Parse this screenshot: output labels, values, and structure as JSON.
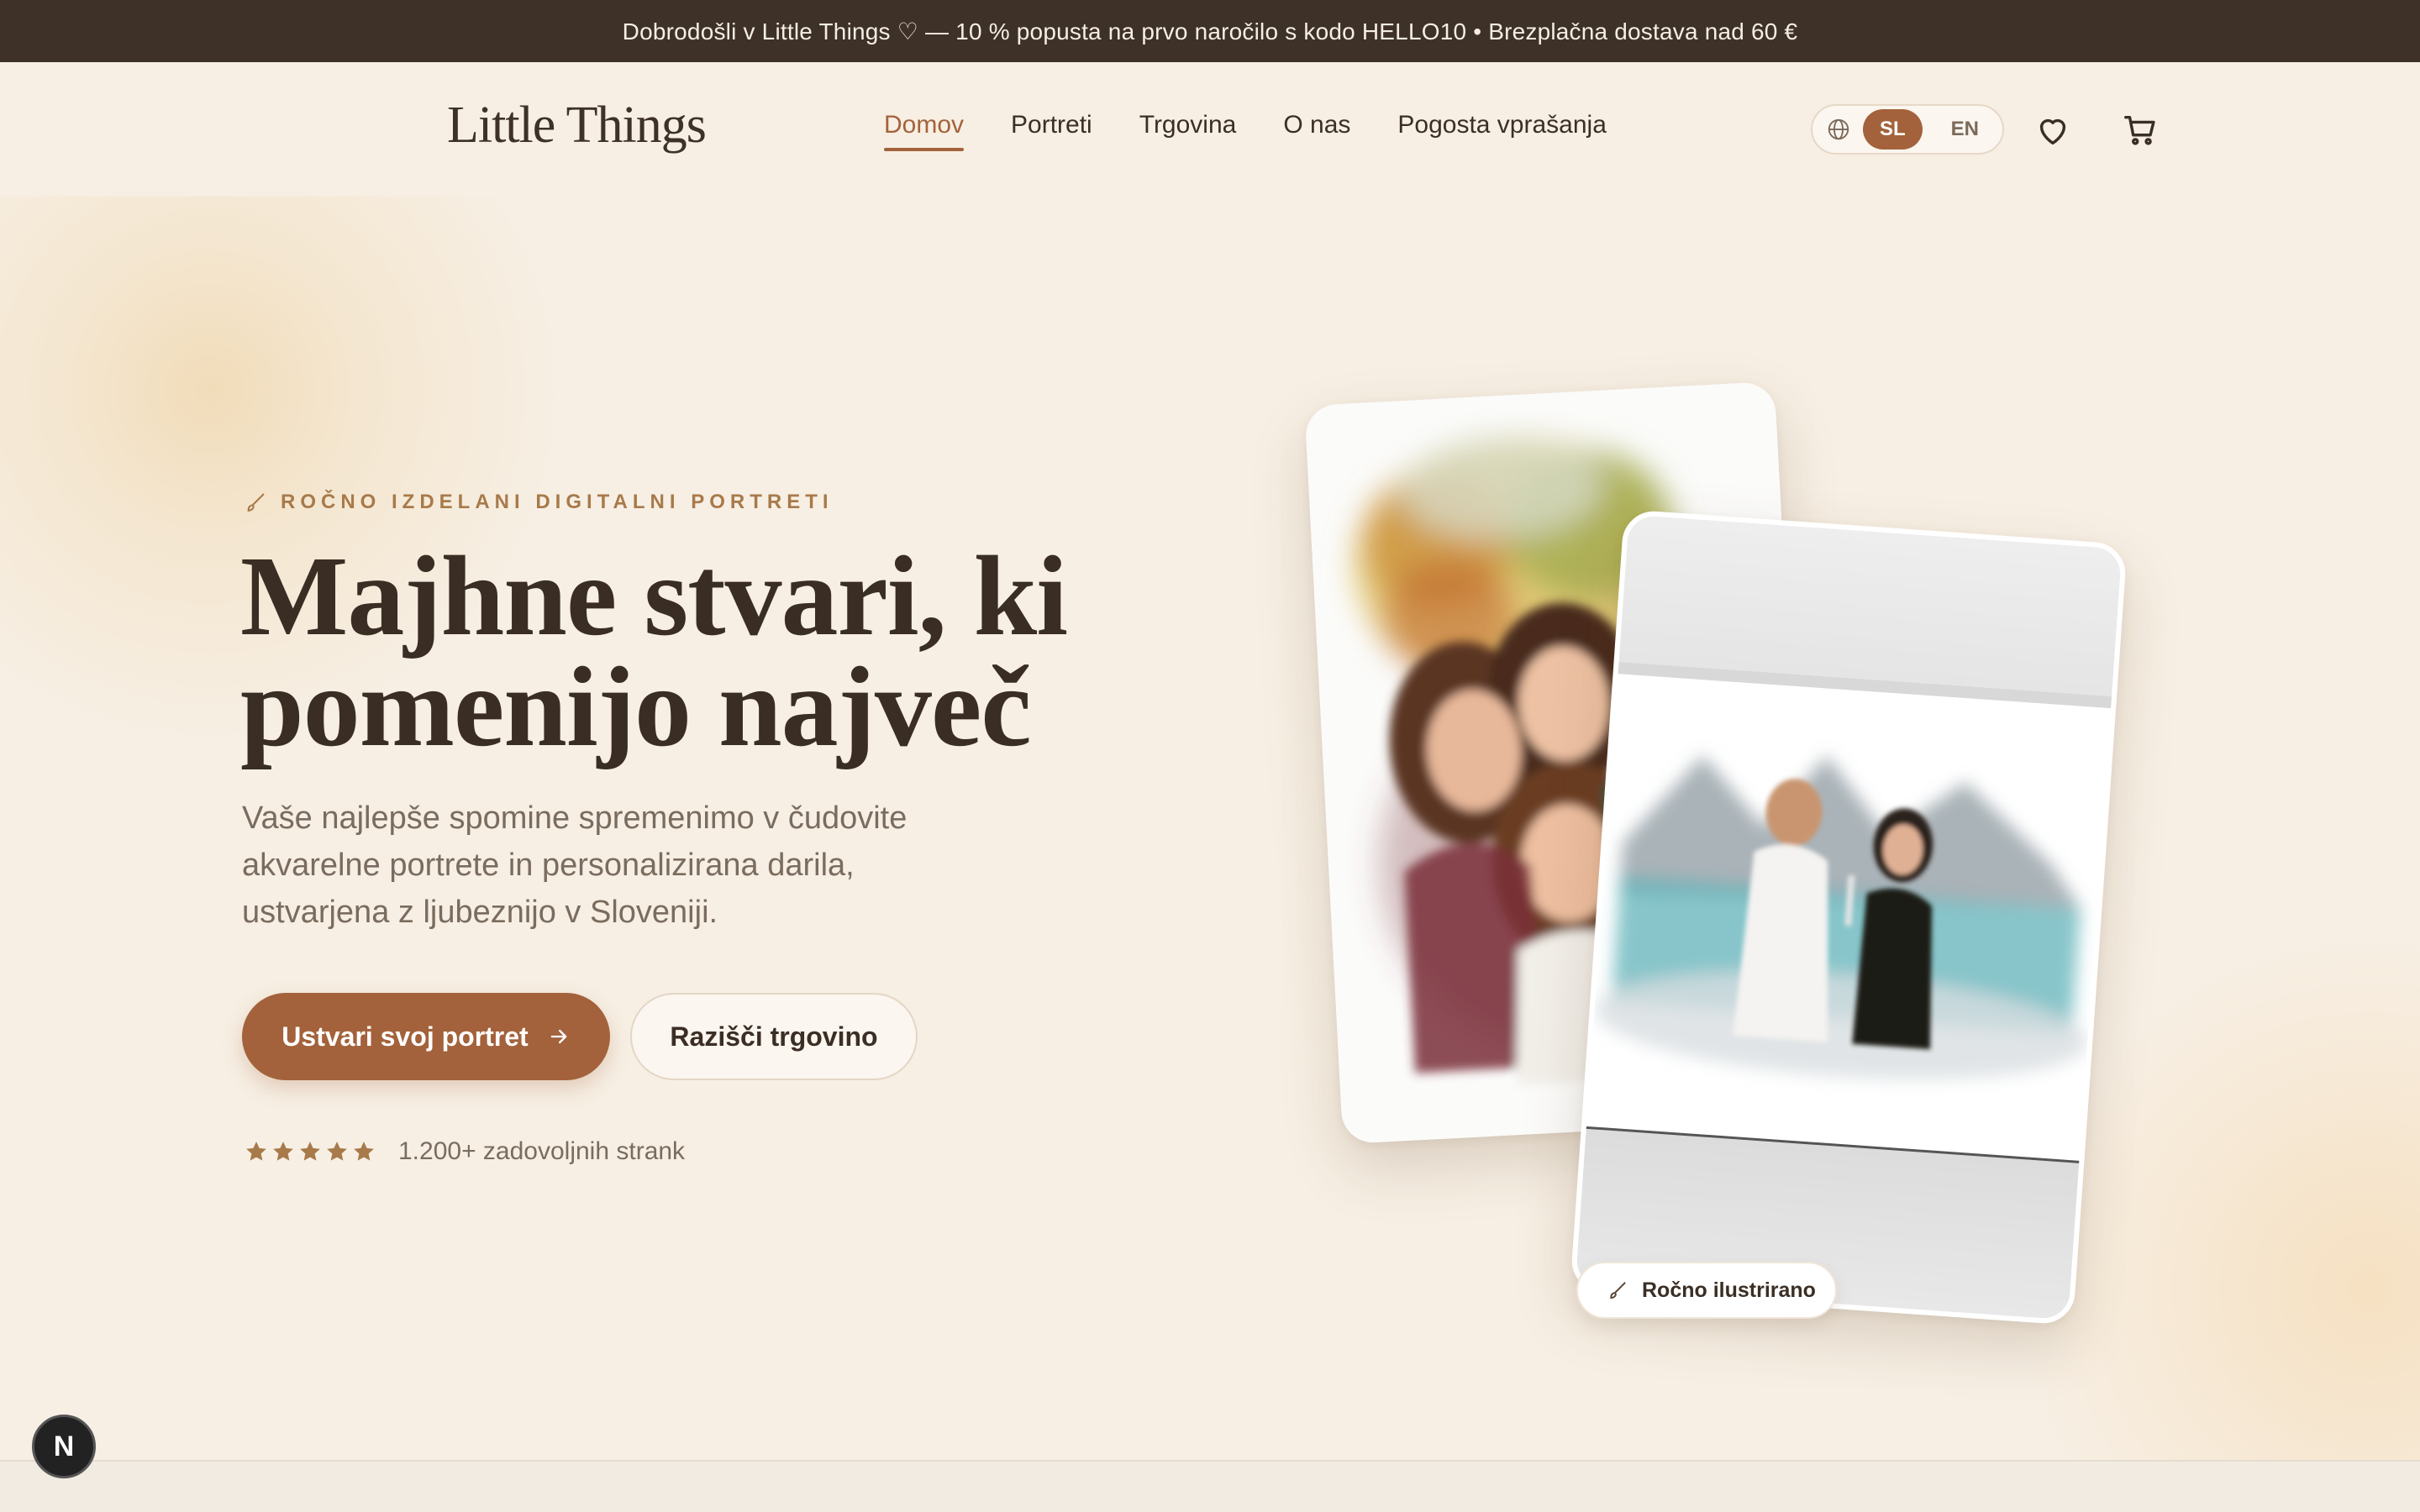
{
  "announcement": {
    "text": "Dobrodošli v Little Things ♡ — 10 % popusta na prvo naročilo s kodo HELLO10 • Brezplačna dostava nad 60 €"
  },
  "header": {
    "logo": "Little Things",
    "nav": [
      {
        "label": "Domov",
        "active": true
      },
      {
        "label": "Portreti"
      },
      {
        "label": "Trgovina"
      },
      {
        "label": "O nas"
      },
      {
        "label": "Pogosta vprašanja"
      }
    ],
    "language": {
      "options": [
        "SL",
        "EN"
      ],
      "selected": "SL"
    },
    "icons": [
      "globe-icon",
      "heart-icon",
      "cart-icon"
    ]
  },
  "hero": {
    "eyebrow": "ROČNO IZDELANI DIGITALNI PORTRETI",
    "headline_line1": "Majhne stvari, ki",
    "headline_line2": "pomenijo največ",
    "subtitle": "Vaše najlepše spomine spremenimo v čudovite akvarelne portrete in personalizirana darila, ustvarjena z ljubeznijo v Sloveniji.",
    "primary_cta": "Ustvari svoj portret",
    "secondary_cta": "Razišči trgovino",
    "rating": {
      "stars": 5,
      "text": "1.200+ zadovoljnih strank"
    },
    "badge": "Ročno ilustrirano"
  },
  "dev_indicator": {
    "label": "N"
  },
  "colors": {
    "accent": "#a3623b",
    "dark": "#3d3128",
    "background": "#f7efe4",
    "gold": "#a87a4a"
  }
}
